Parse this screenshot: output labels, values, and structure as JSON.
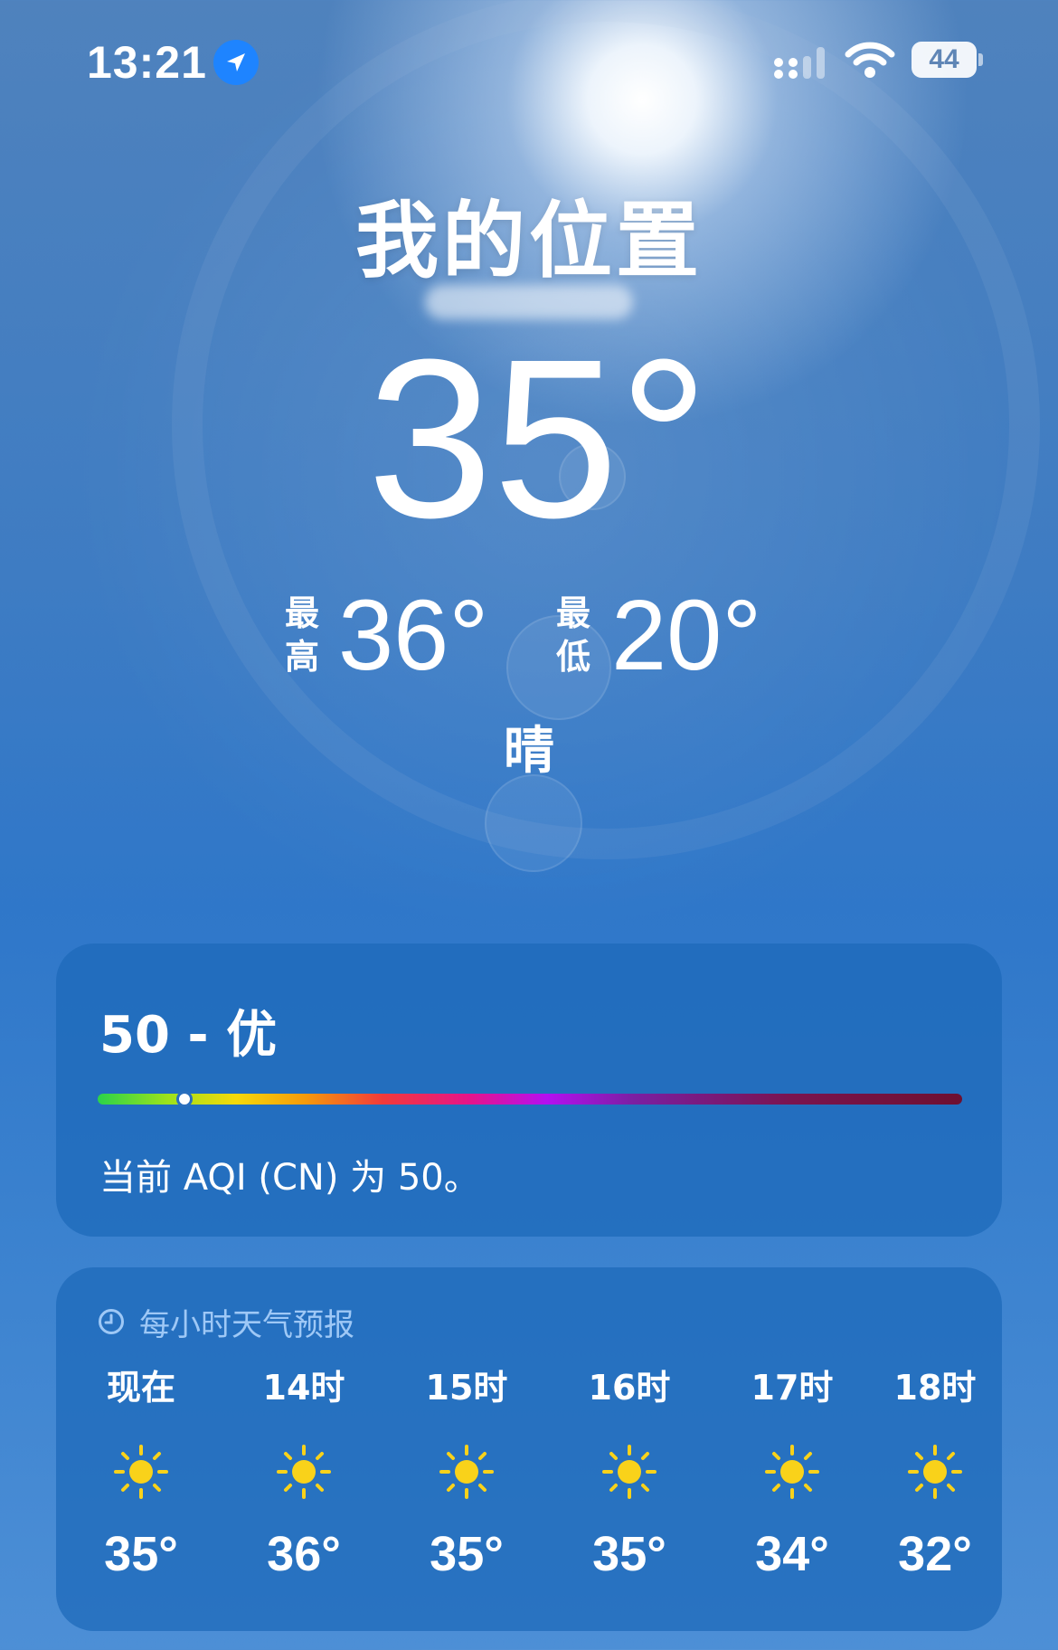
{
  "status_bar": {
    "time": "13:21",
    "battery": "44",
    "icons": [
      "location-arrow-icon",
      "cellular-signal-icon",
      "wifi-icon",
      "battery-icon"
    ]
  },
  "location": {
    "title": "我的位置"
  },
  "current": {
    "temperature": "35°",
    "high_label": "最高",
    "high": "36°",
    "low_label": "最低",
    "low": "20°",
    "condition": "晴"
  },
  "aqi": {
    "value_text": "50 - 优",
    "scale_position": 0.1,
    "description": "当前 AQI (CN) 为 50。"
  },
  "hourly": {
    "header": "每小时天气预报",
    "hours": [
      {
        "label": "现在",
        "icon": "sun-icon",
        "temp": "35°"
      },
      {
        "label": "14时",
        "icon": "sun-icon",
        "temp": "36°"
      },
      {
        "label": "15时",
        "icon": "sun-icon",
        "temp": "35°"
      },
      {
        "label": "16时",
        "icon": "sun-icon",
        "temp": "35°"
      },
      {
        "label": "17时",
        "icon": "sun-icon",
        "temp": "34°"
      },
      {
        "label": "18时",
        "icon": "sun-icon",
        "temp": "32°"
      }
    ]
  },
  "colors": {
    "location_badge": "#1e84ff",
    "sun_icon": "#f9d21a",
    "card": "#1e69b9"
  }
}
